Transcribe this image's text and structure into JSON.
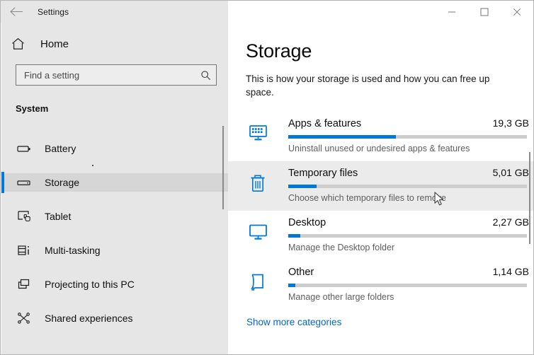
{
  "window": {
    "title": "Settings",
    "back_icon": "back-arrow-icon",
    "minimize_label": "—",
    "maximize_label": "☐",
    "close_label": "✕"
  },
  "sidebar": {
    "home_label": "Home",
    "home_icon": "home-icon",
    "search": {
      "placeholder": "Find a setting",
      "value": "",
      "icon": "search-icon"
    },
    "section_header": "System",
    "items": [
      {
        "label": "Battery",
        "icon": "battery-icon",
        "selected": false
      },
      {
        "label": "Storage",
        "icon": "storage-drive-icon",
        "selected": true
      },
      {
        "label": "Tablet",
        "icon": "tablet-icon",
        "selected": false
      },
      {
        "label": "Multi-tasking",
        "icon": "multitasking-icon",
        "selected": false
      },
      {
        "label": "Projecting to this PC",
        "icon": "projecting-icon",
        "selected": false
      },
      {
        "label": "Shared experiences",
        "icon": "shared-experiences-icon",
        "selected": false
      }
    ]
  },
  "main": {
    "title": "Storage",
    "description": "This is how your storage is used and how you can free up space.",
    "categories": [
      {
        "name": "Apps & features",
        "size": "19,3 GB",
        "subtitle": "Uninstall unused or undesired apps & features",
        "icon": "apps-monitor-icon",
        "fill_percent": 45,
        "hovered": false
      },
      {
        "name": "Temporary files",
        "size": "5,01 GB",
        "subtitle": "Choose which temporary files to remove",
        "icon": "trash-icon",
        "fill_percent": 12,
        "hovered": true
      },
      {
        "name": "Desktop",
        "size": "2,27 GB",
        "subtitle": "Manage the Desktop folder",
        "icon": "desktop-monitor-icon",
        "fill_percent": 5,
        "hovered": false
      },
      {
        "name": "Other",
        "size": "1,14 GB",
        "subtitle": "Manage other large folders",
        "icon": "folder-page-icon",
        "fill_percent": 3,
        "hovered": false
      }
    ],
    "show_more_label": "Show more categories"
  },
  "colors": {
    "accent": "#0078d7",
    "link": "#0066cc",
    "sidebar_bg": "#e6e6e6",
    "bar_track": "#cdcdcd"
  }
}
